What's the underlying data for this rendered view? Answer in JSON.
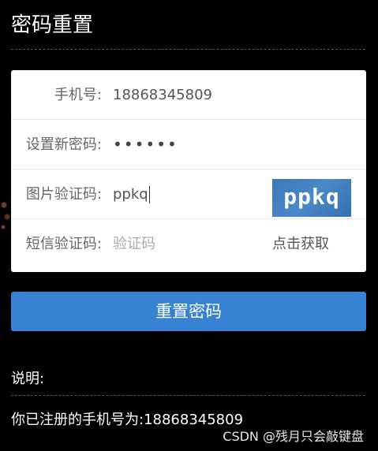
{
  "page": {
    "title": "密码重置"
  },
  "form": {
    "phone": {
      "label": "手机号:",
      "value": "18868345809"
    },
    "new_password": {
      "label": "设置新密码:",
      "value": "••••••"
    },
    "image_captcha": {
      "label": "图片验证码:",
      "value": "ppkq",
      "captcha_image_text": "ppkq"
    },
    "sms_code": {
      "label": "短信验证码:",
      "placeholder": "验证码",
      "get_code_label": "点击获取"
    }
  },
  "actions": {
    "submit_label": "重置密码"
  },
  "notes": {
    "title": "说明:",
    "text": "你已注册的手机号为:18868345809"
  },
  "watermark": "CSDN @残月只会敲键盘",
  "colors": {
    "background": "#000000",
    "card": "#ffffff",
    "primary_button": "#3782d3",
    "captcha_bg": "#3a78b8"
  }
}
